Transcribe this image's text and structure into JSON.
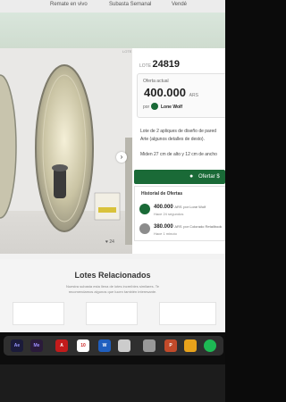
{
  "nav": {
    "items": [
      "Remate en vivo",
      "Subasta Semanal",
      "Vendé"
    ]
  },
  "gallery": {
    "lot_code": "LOTE 24819",
    "likes": "24"
  },
  "lot": {
    "label": "LOTE",
    "number": "24819"
  },
  "bid": {
    "label": "Oferta actual",
    "amount": "400.000",
    "currency": "ARS",
    "by_prefix": "por",
    "bidder": "Lone Wolf"
  },
  "description": {
    "line1": "Lote de 2 apliques de diseño de pared",
    "line2": "Arte (algunos detalles de desto).",
    "line3": "Miden 27 cm de alto y 12 cm de ancho"
  },
  "ofertar_label": "Ofertar $",
  "history": {
    "title": "Historial de Ofertas",
    "entries": [
      {
        "amount": "400.000",
        "currency": "ARS",
        "detail": "por Lone Wolf",
        "time": "Hace 24 segundos"
      },
      {
        "amount": "380.000",
        "currency": "ARS",
        "detail": "por Colorado Retailbook",
        "time": "Hace 1 minuto"
      }
    ]
  },
  "related": {
    "title": "Lotes Relacionados",
    "subtitle1": "Nuestra subasta esta llena de lotes increíbles similares. Te",
    "subtitle2": "recomendamos algunos que lucen también interesante."
  },
  "dock": {
    "icons": [
      "Ae",
      "Me",
      "A",
      "10",
      "W",
      "P"
    ]
  }
}
